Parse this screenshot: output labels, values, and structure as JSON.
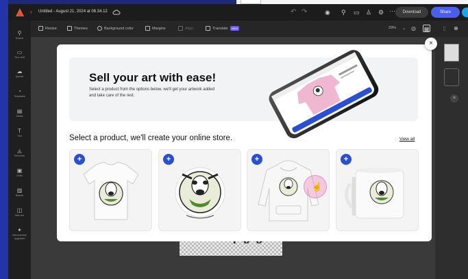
{
  "window": {
    "file_title": "Untitled - August 21, 2024 at 06.34.12"
  },
  "titlebar": {
    "download_label": "Download",
    "share_label": "Share"
  },
  "toolbar": {
    "resize": "Resize",
    "themes": "Themes",
    "background": "Background color",
    "margins": "Margins",
    "align": "Align",
    "translate": "Translate",
    "translate_badge": "NEW",
    "zoom": "29%"
  },
  "sidebar": {
    "items": [
      {
        "label": "Search",
        "icon": "search-icon"
      },
      {
        "label": "Your stuff",
        "icon": "folder-icon"
      },
      {
        "label": "Upload",
        "icon": "upload-icon"
      },
      {
        "label": "Templates",
        "icon": "templates-icon"
      },
      {
        "label": "Media",
        "icon": "media-icon"
      },
      {
        "label": "Text",
        "icon": "text-icon"
      },
      {
        "label": "Elements",
        "icon": "elements-icon"
      },
      {
        "label": "Grids",
        "icon": "grids-icon"
      },
      {
        "label": "Brands",
        "icon": "brands-icon"
      },
      {
        "label": "Add-ons",
        "icon": "addons-icon"
      },
      {
        "label": "Merchandise Upgraded",
        "icon": "merch-icon"
      }
    ]
  },
  "modal": {
    "hero_title": "Sell your art with ease!",
    "hero_description": "Select a product from the options below, we'll get your artwork added and take care of the rest.",
    "section_title": "Select a product, we'll create your online store.",
    "view_all": "View all",
    "products": [
      {
        "name": "t-shirt"
      },
      {
        "name": "sticker"
      },
      {
        "name": "hoodie"
      },
      {
        "name": "mug"
      }
    ]
  },
  "colors": {
    "accent": "#2a4fd6",
    "share": "#4a5ef0",
    "hoodie_pink": "#f0b8d0"
  }
}
